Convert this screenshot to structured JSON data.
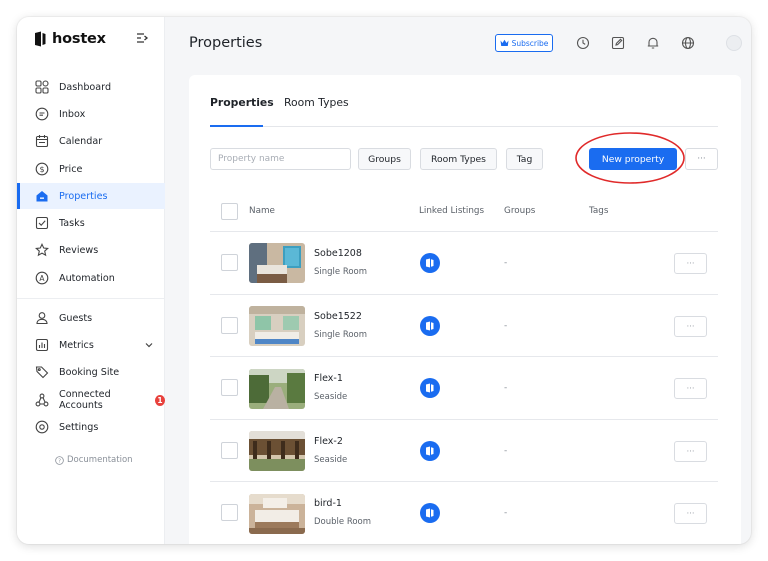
{
  "brand": {
    "name": "hostex",
    "logo_icon": "hostex-logo-icon",
    "collapse_icon": "sidebar-collapse-icon"
  },
  "sidebar": {
    "items": [
      {
        "label": "Dashboard",
        "icon": "dashboard-icon"
      },
      {
        "label": "Inbox",
        "icon": "inbox-icon"
      },
      {
        "label": "Calendar",
        "icon": "calendar-icon"
      },
      {
        "label": "Price",
        "icon": "price-icon"
      },
      {
        "label": "Properties",
        "icon": "home-icon",
        "active": true
      },
      {
        "label": "Tasks",
        "icon": "tasks-icon"
      },
      {
        "label": "Reviews",
        "icon": "star-icon"
      },
      {
        "label": "Automation",
        "icon": "automation-icon"
      },
      {
        "label": "Guests",
        "icon": "user-icon"
      },
      {
        "label": "Metrics",
        "icon": "metrics-icon",
        "expandable": true
      },
      {
        "label": "Booking Site",
        "icon": "booking-site-icon"
      },
      {
        "label": "Connected Accounts",
        "icon": "connected-accounts-icon",
        "badge": "1"
      },
      {
        "label": "Settings",
        "icon": "settings-icon"
      }
    ],
    "documentation": "Documentation"
  },
  "header": {
    "title": "Properties",
    "subscribe_label": "Subscribe",
    "icons": [
      "clock-icon",
      "edit-icon",
      "bell-icon",
      "globe-icon",
      "avatar"
    ]
  },
  "tabs": [
    {
      "label": "Properties",
      "active": true
    },
    {
      "label": "Room Types",
      "active": false
    }
  ],
  "filters": {
    "search_placeholder": "Property name",
    "search_value": "",
    "groups_label": "Groups",
    "room_types_label": "Room Types",
    "tag_label": "Tag",
    "new_property_label": "New property",
    "more_label": "···"
  },
  "table": {
    "columns": [
      "Name",
      "Linked Listings",
      "Groups",
      "Tags"
    ],
    "rows": [
      {
        "name": "Sobe1208",
        "room_type": "Single Room",
        "groups": "-",
        "more": "···"
      },
      {
        "name": "Sobe1522",
        "room_type": "Single Room",
        "groups": "-",
        "more": "···"
      },
      {
        "name": "Flex-1",
        "room_type": "Seaside",
        "groups": "-",
        "more": "···"
      },
      {
        "name": "Flex-2",
        "room_type": "Seaside",
        "groups": "-",
        "more": "···"
      },
      {
        "name": "bird-1",
        "room_type": "Double Room",
        "groups": "-",
        "more": "···"
      }
    ]
  },
  "colors": {
    "accent": "#1a6cf0",
    "badge": "#e8413c",
    "annotation": "#e02a2a",
    "sidebar_active_bg": "#eaf2ff"
  }
}
